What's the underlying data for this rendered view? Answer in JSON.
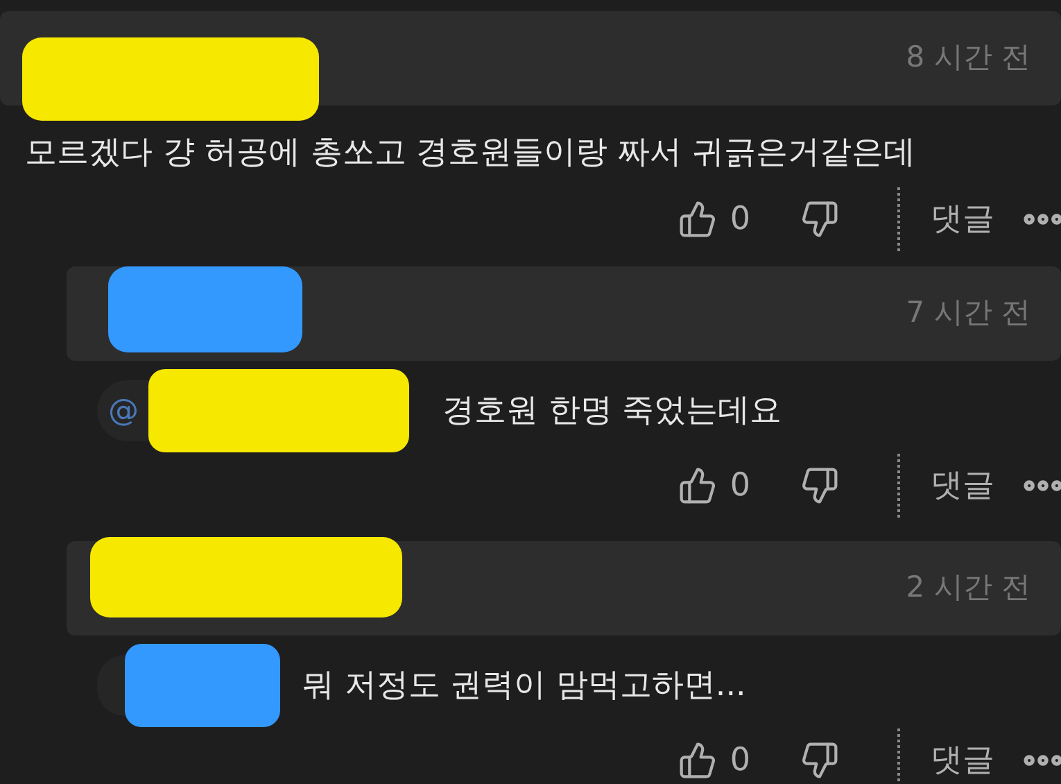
{
  "comments": [
    {
      "time": "8 시간 전",
      "author_redaction": {
        "color": "#f7e800"
      },
      "text": "모르겠다 걍 허공에 총쏘고 경호원들이랑 짜서 귀긁은거같은데",
      "likes": "0",
      "reply_label": "댓글",
      "replies": [
        {
          "time": "7 시간 전",
          "author_redaction": {
            "color": "#3399ff"
          },
          "mention": {
            "at": "@",
            "redaction": {
              "color": "#f7e800"
            }
          },
          "text": "경호원 한명 죽었는데요",
          "likes": "0",
          "reply_label": "댓글"
        },
        {
          "time": "2 시간 전",
          "author_redaction": {
            "color": "#f7e800"
          },
          "mention": {
            "redaction": {
              "color": "#3399ff"
            }
          },
          "text": "뭐 저정도 권력이 맘먹고하면...",
          "likes": "0",
          "reply_label": "댓글"
        }
      ]
    }
  ]
}
